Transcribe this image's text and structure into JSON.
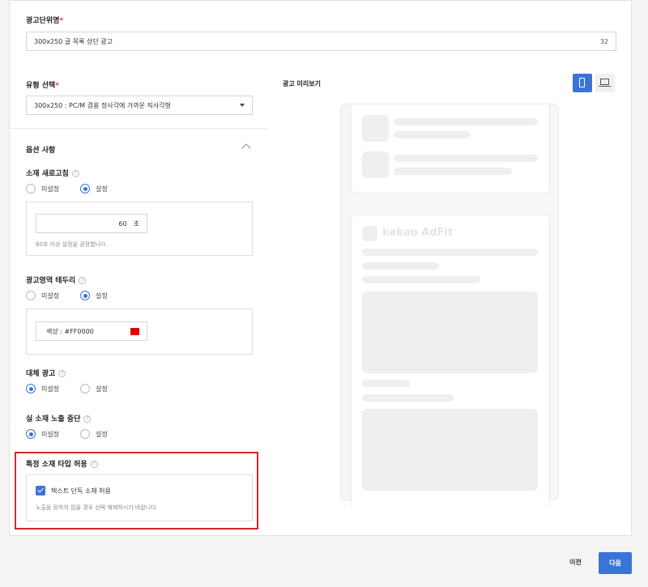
{
  "ad_unit": {
    "label": "광고단위명",
    "required_mark": "*",
    "value": "300x250 글 목록 상단 광고",
    "char_count": "32"
  },
  "type_select": {
    "label": "유형 선택",
    "required_mark": "*",
    "value": "300x250 : PC/M 겸용 정사각에 가까운 직사각형"
  },
  "options": {
    "title": "옵션 사항",
    "refresh": {
      "label": "소재 새로고침",
      "opt_off": "미설정",
      "opt_on": "설정",
      "selected": "설정",
      "seconds": "60",
      "unit": "초",
      "hint": "60초 이상 설정을 권장합니다."
    },
    "border": {
      "label": "광고영역 테두리",
      "opt_off": "미설정",
      "opt_on": "설정",
      "selected": "설정",
      "color_text": "색상 : #FF0000",
      "color": "#e00000"
    },
    "alt_ad": {
      "label": "대체 광고",
      "opt_off": "미설정",
      "opt_on": "설정",
      "selected": "미설정"
    },
    "stop": {
      "label": "실 소재 노출 중단",
      "opt_off": "미설정",
      "opt_on": "설정",
      "selected": "미설정"
    },
    "allow_type": {
      "label": "특정 소재 타입 허용",
      "checkbox_label": "텍스트 단독 소재 허용",
      "checked": true,
      "hint": "노출을 원하지 않을 경우 선택 해제하시기 바랍니다."
    }
  },
  "preview": {
    "title": "광고 미리보기",
    "watermark": "kakao AdFit"
  },
  "footer": {
    "prev_label": "이전",
    "next_label": "다음"
  },
  "colors": {
    "accent": "#3a74d8",
    "highlight": "#d9252a"
  },
  "icons": {
    "mobile": "mobile-icon",
    "desktop": "desktop-icon",
    "help": "question-circle-icon",
    "collapse": "chevron-up-icon",
    "dropdown": "caret-down-icon"
  }
}
